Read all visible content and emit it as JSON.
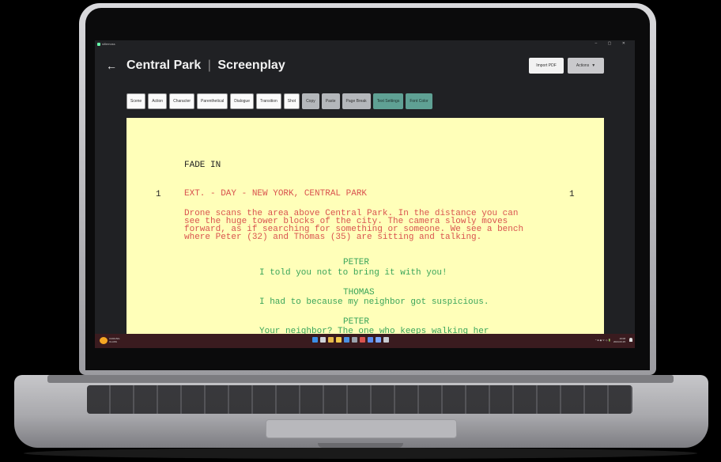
{
  "window": {
    "app_title": "sitlemoss",
    "controls": "– ▢ ✕"
  },
  "header": {
    "back_icon": "←",
    "title": "Central Park",
    "separator": "|",
    "subtitle": "Screenplay",
    "import_label": "Import PDF",
    "actions_label": "Actions",
    "actions_caret": "▼"
  },
  "toolbar": {
    "scene": "Scene",
    "action": "Action",
    "character": "Character",
    "parenthetical": "Parenthetical",
    "dialogue": "Dialogue",
    "transition": "Transition",
    "shot": "Shot",
    "copy": "Copy",
    "paste": "Paste",
    "page_break": "Page Break",
    "text_settings": "Text Settings",
    "font_color": "Font Color"
  },
  "script": {
    "transition": "FADE IN",
    "scene_number": "1",
    "scene_heading": "EXT. - DAY - NEW YORK, CENTRAL PARK",
    "action": "Drone scans the area above Central Park. In the distance you can\nsee the huge tower blocks of the city. The camera slowly moves\nforward, as if searching for something or someone. We see a bench\nwhere Peter (32) and Thomas (35) are sitting and talking.",
    "lines": [
      {
        "character": "PETER",
        "dialogue": "I told you not to bring it with you!"
      },
      {
        "character": "THOMAS",
        "dialogue": "I had to because my neighbor got suspicious."
      },
      {
        "character": "PETER",
        "dialogue": "Your neighbor? The one who keeps walking  her"
      }
    ]
  },
  "taskbar": {
    "weather_line1": "CURLING",
    "weather_line2": "CLASS",
    "tray": "^ ⊕ ◉ ᯤ ⌂) 🔋",
    "time": "19:08",
    "date": "2024.03.25"
  },
  "colors": {
    "paper": "#ffffb9",
    "scene_text": "#d9534f",
    "dialogue_text": "#3aa55a",
    "app_bg": "#202124",
    "teal_button": "#5fa194"
  }
}
